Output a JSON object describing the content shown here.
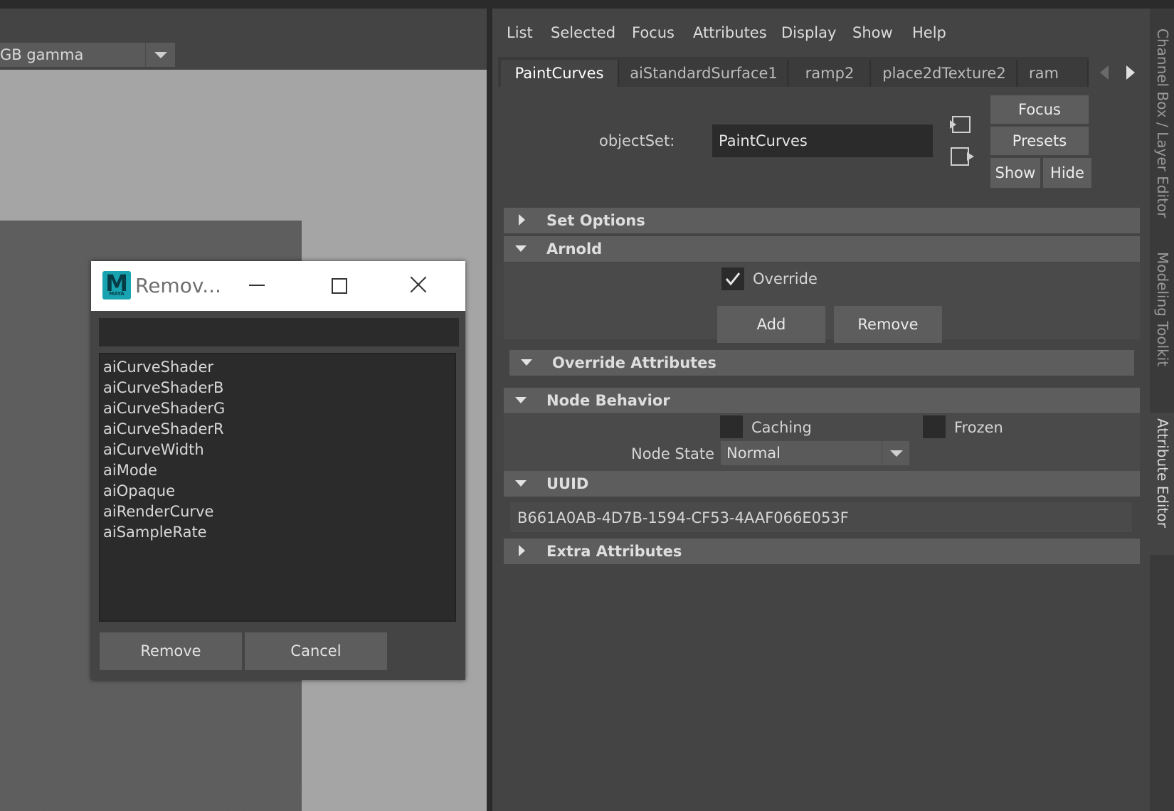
{
  "viewport": {
    "colorspace_label": "GB gamma"
  },
  "dialog": {
    "title": "Remov...",
    "logo_letter": "M",
    "logo_sub": "MAYA",
    "filter_value": "",
    "items": [
      "aiCurveShader",
      "aiCurveShaderB",
      "aiCurveShaderG",
      "aiCurveShaderR",
      "aiCurveWidth",
      "aiMode",
      "aiOpaque",
      "aiRenderCurve",
      "aiSampleRate"
    ],
    "remove_label": "Remove",
    "cancel_label": "Cancel"
  },
  "menu": [
    "List",
    "Selected",
    "Focus",
    "Attributes",
    "Display",
    "Show",
    "Help"
  ],
  "tabs": [
    "PaintCurves",
    "aiStandardSurface1",
    "ramp2",
    "place2dTexture2",
    "ram"
  ],
  "active_tab": "PaintCurves",
  "object_set": {
    "label": "objectSet:",
    "value": "PaintCurves"
  },
  "side_buttons": {
    "focus": "Focus",
    "presets": "Presets",
    "show": "Show",
    "hide": "Hide"
  },
  "sections": {
    "set_options": "Set Options",
    "arnold": "Arnold",
    "override_attributes": "Override Attributes",
    "node_behavior": "Node Behavior",
    "uuid": "UUID",
    "extra_attributes": "Extra Attributes"
  },
  "arnold": {
    "override_label": "Override",
    "override_checked": true,
    "add_label": "Add",
    "remove_label": "Remove"
  },
  "node_behavior": {
    "caching_label": "Caching",
    "caching_checked": false,
    "frozen_label": "Frozen",
    "frozen_checked": false,
    "node_state_label": "Node State",
    "node_state_value": "Normal"
  },
  "uuid_value": "B661A0AB-4D7B-1594-CF53-4AAF066E053F",
  "side_tabs": [
    "Channel Box / Layer Editor",
    "Modeling Toolkit",
    "Attribute Editor"
  ],
  "active_side_tab": "Attribute Editor"
}
